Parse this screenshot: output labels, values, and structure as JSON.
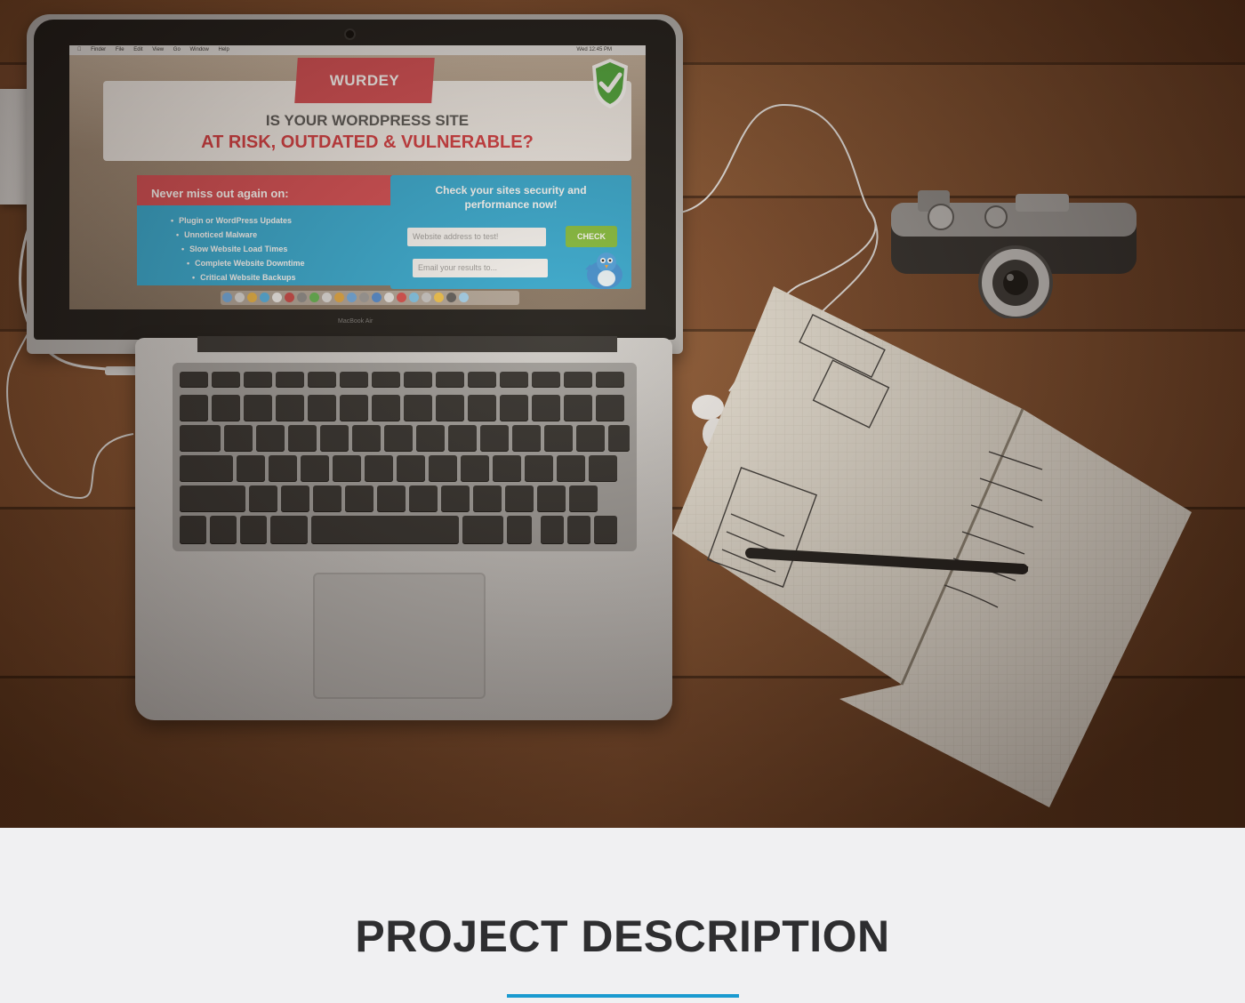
{
  "hero": {
    "laptop_screen": {
      "menubar": [
        "Finder",
        "File",
        "Edit",
        "View",
        "Go",
        "Window",
        "Help"
      ],
      "clock": "Wed 12:45 PM",
      "logo": "WURDEY",
      "headline_line1": "IS YOUR WORDPRESS SITE",
      "headline_line2": "AT RISK, OUTDATED & VULNERABLE?",
      "left_box_title": "Never miss out again on:",
      "bullets": [
        "Plugin or WordPress Updates",
        "Unnoticed Malware",
        "Slow Website Load Times",
        "Complete Website Downtime",
        "Critical Website Backups"
      ],
      "cta_line1": "Check your sites security and",
      "cta_line2": "performance now!",
      "website_placeholder": "Website address to test!",
      "email_placeholder": "Email your results to...",
      "check_button": "CHECK"
    },
    "laptop_brand": "MacBook Air"
  },
  "section": {
    "title": "PROJECT DESCRIPTION",
    "accent_color": "#1a9ad0"
  },
  "icons": [
    "shield-check-icon",
    "bird-mascot-icon",
    "apple-icon"
  ]
}
